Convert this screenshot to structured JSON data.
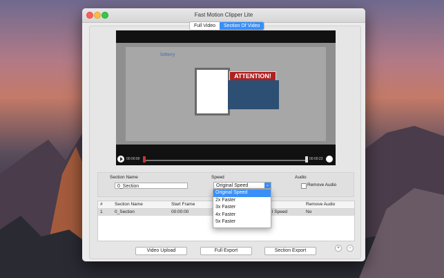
{
  "window": {
    "title": "Fast Motion Clipper Lite"
  },
  "tabs": [
    {
      "label": "Full Video",
      "active": false
    },
    {
      "label": "Section Of Video",
      "active": true
    }
  ],
  "player": {
    "video_overlay_text": "ATTENTION!",
    "site_logo_text": "lottery",
    "time_current": "00:00:00",
    "time_total": "00:00:23"
  },
  "settings": {
    "section_name_label": "Section Name",
    "section_name_value": "0_Section",
    "speed_label": "Speed",
    "speed_value": "Original Speed",
    "audio_label": "Audio",
    "remove_audio_label": "Remove Audio",
    "remove_audio_checked": false
  },
  "speed_options": [
    "Original Speed",
    "2x Faster",
    "3x Faster",
    "4x Faster",
    "5x Faster"
  ],
  "table": {
    "headers": [
      "#",
      "Section Name",
      "Start Frame",
      "Remove Audio"
    ],
    "rows": [
      {
        "num": "1",
        "section_name": "0_Section",
        "start_frame": "00:00:00",
        "speed": "l Speed",
        "remove_audio": "No"
      }
    ]
  },
  "buttons": {
    "video_upload": "Video Upload",
    "full_export": "Full Export",
    "section_export": "Section Export",
    "add": "+",
    "remove": "−"
  },
  "colors": {
    "accent": "#3a8ff7",
    "attention_red": "#b02020"
  }
}
